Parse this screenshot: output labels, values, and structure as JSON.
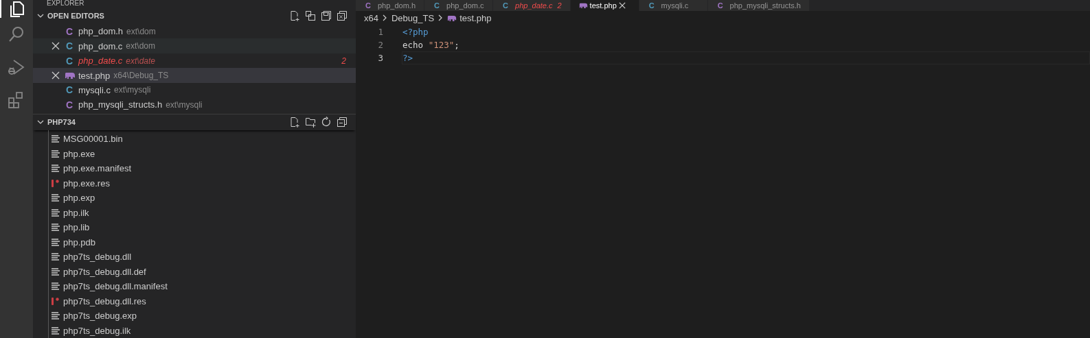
{
  "activity_bar": [
    {
      "kind": "explorer",
      "selected": true
    },
    {
      "kind": "search",
      "selected": false
    },
    {
      "kind": "debug",
      "selected": false
    },
    {
      "kind": "extensions",
      "selected": false
    }
  ],
  "sidebar": {
    "title": "EXPLORER",
    "open_editors": {
      "title": "OPEN EDITORS",
      "expanded": true,
      "items": [
        {
          "name": "php_dom.h",
          "path": "ext\\dom",
          "kind": "header",
          "icon_text": "C",
          "hovered": false,
          "selected": false,
          "error": false
        },
        {
          "name": "php_dom.c",
          "path": "ext\\dom",
          "kind": "source",
          "icon_text": "C",
          "hovered": true,
          "selected": false,
          "error": false
        },
        {
          "name": "php_date.c",
          "path": "ext\\date",
          "kind": "source",
          "icon_text": "C",
          "hovered": false,
          "selected": false,
          "error": true,
          "badge": "2"
        },
        {
          "name": "test.php",
          "path": "x64\\Debug_TS",
          "kind": "php",
          "hovered": false,
          "selected": true,
          "error": false
        },
        {
          "name": "mysqli.c",
          "path": "ext\\mysqli",
          "kind": "source",
          "icon_text": "C",
          "hovered": false,
          "selected": false,
          "error": false
        },
        {
          "name": "php_mysqli_structs.h",
          "path": "ext\\mysqli",
          "kind": "header",
          "icon_text": "C",
          "hovered": false,
          "selected": false,
          "error": false
        }
      ]
    },
    "folder": {
      "title": "PHP734",
      "expanded": true,
      "items": [
        {
          "name": "MSG00001.bin",
          "kind": "text"
        },
        {
          "name": "php.exe",
          "kind": "text"
        },
        {
          "name": "php.exe.manifest",
          "kind": "text"
        },
        {
          "name": "php.exe.res",
          "kind": "resource"
        },
        {
          "name": "php.exp",
          "kind": "text"
        },
        {
          "name": "php.ilk",
          "kind": "text"
        },
        {
          "name": "php.lib",
          "kind": "text"
        },
        {
          "name": "php.pdb",
          "kind": "text"
        },
        {
          "name": "php7ts_debug.dll",
          "kind": "text"
        },
        {
          "name": "php7ts_debug.dll.def",
          "kind": "text"
        },
        {
          "name": "php7ts_debug.dll.manifest",
          "kind": "text"
        },
        {
          "name": "php7ts_debug.dll.res",
          "kind": "resource"
        },
        {
          "name": "php7ts_debug.exp",
          "kind": "text"
        },
        {
          "name": "php7ts_debug.ilk",
          "kind": "text"
        }
      ]
    }
  },
  "editor": {
    "tabs": [
      {
        "label": "php_dom.h",
        "kind": "header",
        "icon_text": "C",
        "selected": false,
        "error": false
      },
      {
        "label": "php_dom.c",
        "kind": "source",
        "icon_text": "C",
        "selected": false,
        "error": false
      },
      {
        "label": "php_date.c",
        "kind": "source",
        "icon_text": "C",
        "selected": false,
        "error": true,
        "badge": "2"
      },
      {
        "label": "test.php",
        "kind": "php",
        "selected": true,
        "error": false
      },
      {
        "label": "mysqli.c",
        "kind": "source",
        "icon_text": "C",
        "selected": false,
        "error": false
      },
      {
        "label": "php_mysqli_structs.h",
        "kind": "header",
        "icon_text": "C",
        "selected": false,
        "error": false
      }
    ],
    "breadcrumbs": [
      {
        "label": "x64",
        "kind": "folder"
      },
      {
        "label": "Debug_TS",
        "kind": "folder"
      },
      {
        "label": "test.php",
        "kind": "php"
      }
    ],
    "lines": [
      {
        "number": "1",
        "current": false,
        "tokens": [
          {
            "text": "<?php",
            "kind": "tag"
          }
        ]
      },
      {
        "number": "2",
        "current": false,
        "tokens": [
          {
            "text": "echo ",
            "kind": "keyword"
          },
          {
            "text": "\"123\"",
            "kind": "string"
          },
          {
            "text": ";",
            "kind": "plain"
          }
        ]
      },
      {
        "number": "3",
        "current": true,
        "tokens": [
          {
            "text": "?>",
            "kind": "tag"
          }
        ]
      }
    ]
  }
}
